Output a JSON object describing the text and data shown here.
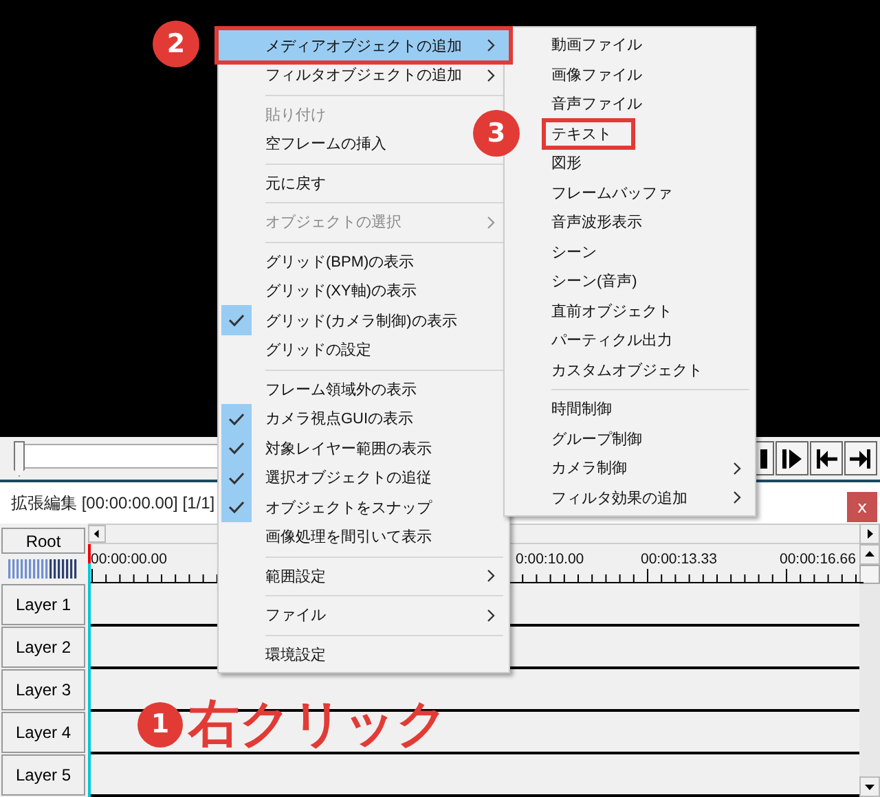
{
  "playback": {
    "slider": {
      "level": 0
    },
    "buttons": [
      {
        "kind": "bar"
      },
      {
        "kind": "step"
      },
      {
        "kind": "to_start"
      },
      {
        "kind": "to_end"
      }
    ]
  },
  "timeline": {
    "title": "拡張編集 [00:00:00.00] [1/1]",
    "close": "x",
    "root": "Root",
    "time_labels": [
      "00:00:00.00",
      "0:00:10.00",
      "00:00:13.33",
      "00:00:16.66"
    ],
    "layers": [
      "Layer 1",
      "Layer 2",
      "Layer 3",
      "Layer 4",
      "Layer 5"
    ],
    "callout": {
      "number": "1",
      "text": "右クリック"
    }
  },
  "context_menu": {
    "items": [
      {
        "kind": "item",
        "label": "メディアオブジェクトの追加",
        "selected": true,
        "checked": false,
        "disabled": false,
        "has_submenu": true,
        "outlined": true,
        "badge": "2"
      },
      {
        "kind": "item",
        "label": "フィルタオブジェクトの追加",
        "selected": false,
        "checked": false,
        "disabled": false,
        "has_submenu": true,
        "outlined": false
      },
      {
        "kind": "separator"
      },
      {
        "kind": "item",
        "label": "貼り付け",
        "selected": false,
        "checked": false,
        "disabled": true,
        "outlined": false
      },
      {
        "kind": "item",
        "label": "空フレームの挿入",
        "selected": false,
        "checked": false,
        "disabled": false,
        "outlined": false
      },
      {
        "kind": "separator"
      },
      {
        "kind": "item",
        "label": "元に戻す",
        "selected": false,
        "checked": false,
        "disabled": false,
        "has_submenu": false,
        "outlined": false
      },
      {
        "kind": "separator"
      },
      {
        "kind": "item",
        "label": "オブジェクトの選択",
        "selected": false,
        "checked": false,
        "disabled": true,
        "has_submenu": true,
        "outlined": false
      },
      {
        "kind": "separator"
      },
      {
        "kind": "item",
        "label": "グリッド(BPM)の表示",
        "selected": false,
        "checked": false,
        "disabled": false,
        "has_submenu": false,
        "outlined": false
      },
      {
        "kind": "item",
        "label": "グリッド(XY軸)の表示",
        "selected": false,
        "checked": false,
        "disabled": false,
        "has_submenu": false,
        "outlined": false
      },
      {
        "kind": "item",
        "label": "グリッド(カメラ制御)の表示",
        "selected": false,
        "checked": true,
        "disabled": false,
        "has_submenu": false,
        "outlined": false
      },
      {
        "kind": "item",
        "label": "グリッドの設定",
        "selected": false,
        "checked": false,
        "disabled": false,
        "has_submenu": false,
        "outlined": false
      },
      {
        "kind": "separator"
      },
      {
        "kind": "item",
        "label": "フレーム領域外の表示",
        "selected": false,
        "checked": false,
        "disabled": false,
        "has_submenu": false,
        "outlined": false
      },
      {
        "kind": "item",
        "label": "カメラ視点GUIの表示",
        "selected": false,
        "checked": true,
        "disabled": false,
        "has_submenu": false,
        "outlined": false
      },
      {
        "kind": "item",
        "label": "対象レイヤー範囲の表示",
        "selected": false,
        "checked": true,
        "disabled": false,
        "has_submenu": false,
        "outlined": false
      },
      {
        "kind": "item",
        "label": "選択オブジェクトの追従",
        "selected": false,
        "checked": true,
        "disabled": false,
        "has_submenu": false,
        "outlined": false
      },
      {
        "kind": "item",
        "label": "オブジェクトをスナップ",
        "selected": false,
        "checked": true,
        "disabled": false,
        "has_submenu": false,
        "outlined": false
      },
      {
        "kind": "item",
        "label": "画像処理を間引いて表示",
        "selected": false,
        "checked": false,
        "disabled": false,
        "has_submenu": false,
        "outlined": false
      },
      {
        "kind": "separator"
      },
      {
        "kind": "item",
        "label": "範囲設定",
        "selected": false,
        "checked": false,
        "disabled": false,
        "has_submenu": true,
        "outlined": false
      },
      {
        "kind": "separator"
      },
      {
        "kind": "item",
        "label": "ファイル",
        "selected": false,
        "checked": false,
        "disabled": false,
        "has_submenu": true,
        "outlined": false
      },
      {
        "kind": "separator"
      },
      {
        "kind": "item",
        "label": "環境設定",
        "selected": false,
        "checked": false,
        "disabled": false,
        "has_submenu": false,
        "outlined": false
      }
    ]
  },
  "submenu": {
    "items": [
      {
        "kind": "item",
        "label": "動画ファイル",
        "selected": false,
        "checked": false,
        "disabled": false,
        "has_submenu": false,
        "outlined": false
      },
      {
        "kind": "item",
        "label": "画像ファイル",
        "selected": false,
        "checked": false,
        "disabled": false,
        "has_submenu": false,
        "outlined": false
      },
      {
        "kind": "item",
        "label": "音声ファイル",
        "selected": false,
        "checked": false,
        "disabled": false,
        "has_submenu": false,
        "outlined": false
      },
      {
        "kind": "item",
        "label": "テキスト",
        "selected": false,
        "checked": false,
        "disabled": false,
        "has_submenu": false,
        "outlined": true,
        "badge": "3"
      },
      {
        "kind": "item",
        "label": "図形",
        "selected": false,
        "checked": false,
        "disabled": false,
        "has_submenu": false,
        "outlined": false
      },
      {
        "kind": "item",
        "label": "フレームバッファ",
        "selected": false,
        "checked": false,
        "disabled": false,
        "has_submenu": false,
        "outlined": false
      },
      {
        "kind": "item",
        "label": "音声波形表示",
        "selected": false,
        "checked": false,
        "disabled": false,
        "has_submenu": false,
        "outlined": false
      },
      {
        "kind": "item",
        "label": "シーン",
        "selected": false,
        "checked": false,
        "disabled": false,
        "has_submenu": false,
        "outlined": false
      },
      {
        "kind": "item",
        "label": "シーン(音声)",
        "selected": false,
        "checked": false,
        "disabled": false,
        "has_submenu": false,
        "outlined": false
      },
      {
        "kind": "item",
        "label": "直前オブジェクト",
        "selected": false,
        "checked": false,
        "disabled": false,
        "has_submenu": false,
        "outlined": false
      },
      {
        "kind": "item",
        "label": "パーティクル出力",
        "selected": false,
        "checked": false,
        "disabled": false,
        "has_submenu": false,
        "outlined": false
      },
      {
        "kind": "item",
        "label": "カスタムオブジェクト",
        "selected": false,
        "checked": false,
        "disabled": false,
        "has_submenu": false,
        "outlined": false
      },
      {
        "kind": "separator"
      },
      {
        "kind": "item",
        "label": "時間制御",
        "selected": false,
        "checked": false,
        "disabled": false,
        "has_submenu": false,
        "outlined": false
      },
      {
        "kind": "item",
        "label": "グループ制御",
        "selected": false,
        "checked": false,
        "disabled": false,
        "has_submenu": false,
        "outlined": false
      },
      {
        "kind": "item",
        "label": "カメラ制御",
        "selected": false,
        "checked": false,
        "disabled": false,
        "has_submenu": true,
        "outlined": false
      },
      {
        "kind": "item",
        "label": "フィルタ効果の追加",
        "selected": false,
        "checked": false,
        "disabled": false,
        "has_submenu": true,
        "outlined": false
      }
    ]
  }
}
